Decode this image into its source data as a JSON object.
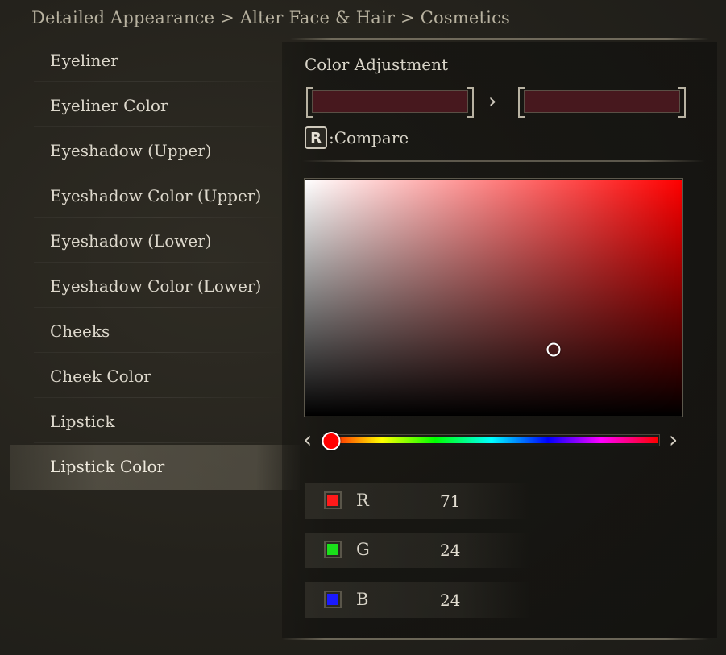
{
  "breadcrumb": "Detailed Appearance > Alter Face & Hair > Cosmetics",
  "sidebar": {
    "items": [
      {
        "label": "Eyeliner",
        "active": false
      },
      {
        "label": "Eyeliner Color",
        "active": false
      },
      {
        "label": "Eyeshadow (Upper)",
        "active": false
      },
      {
        "label": "Eyeshadow Color (Upper)",
        "active": false
      },
      {
        "label": "Eyeshadow (Lower)",
        "active": false
      },
      {
        "label": "Eyeshadow Color (Lower)",
        "active": false
      },
      {
        "label": "Cheeks",
        "active": false
      },
      {
        "label": "Cheek Color",
        "active": false
      },
      {
        "label": "Lipstick",
        "active": false
      },
      {
        "label": "Lipstick Color",
        "active": true
      }
    ]
  },
  "panel": {
    "title": "Color Adjustment",
    "compare_key": "R",
    "compare_label": ":Compare",
    "previous_color": "#47181e",
    "current_color": "#47181e",
    "picker": {
      "hue_color": "#ff0000",
      "saturation": 0.66,
      "value": 0.28,
      "hue_position": 0.0
    },
    "channels": [
      {
        "name": "R",
        "value": "71",
        "chip_color": "#ff1a1a"
      },
      {
        "name": "G",
        "value": "24",
        "chip_color": "#1adf1a"
      },
      {
        "name": "B",
        "value": "24",
        "chip_color": "#1a1aff"
      }
    ]
  }
}
